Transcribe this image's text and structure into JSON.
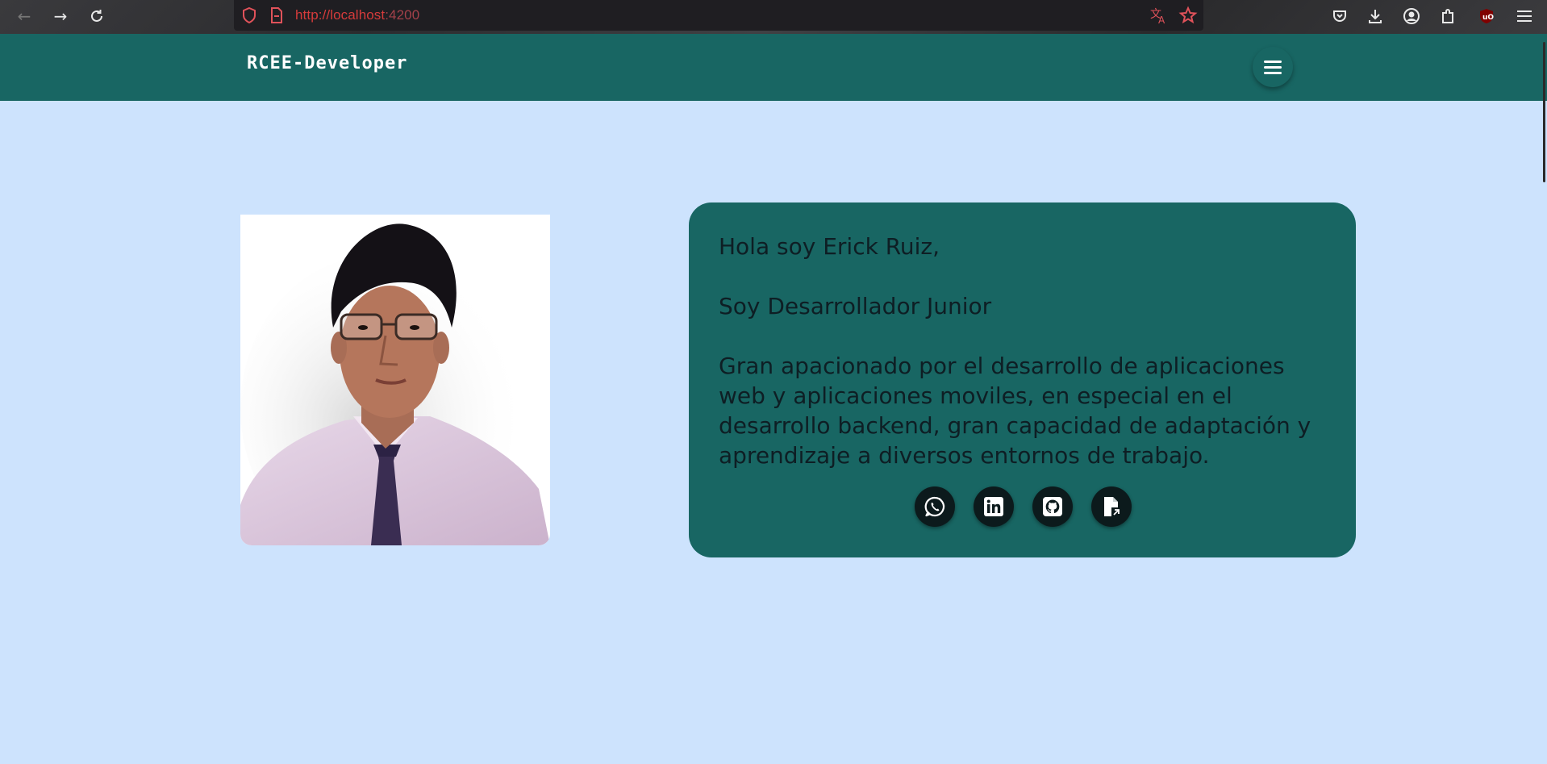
{
  "browser": {
    "url_host": "http://localhost",
    "url_port": ":4200"
  },
  "header": {
    "brand": "RCEE-Developer"
  },
  "card": {
    "greeting": "Hola soy Erick Ruiz,",
    "role": "Soy Desarrollador Junior",
    "bio": "Gran apacionado por el desarrollo de aplicaciones web y aplicaciones moviles, en especial en el desarrollo backend, gran capacidad de adaptación y aprendizaje a diversos entornos de trabajo."
  },
  "socials": [
    {
      "icon": "whatsapp-icon"
    },
    {
      "icon": "linkedin-icon"
    },
    {
      "icon": "github-icon"
    },
    {
      "icon": "file-download-icon"
    }
  ],
  "colors": {
    "page_bg": "#cde3fd",
    "accent": "#186663",
    "social_bg": "#0c1a1c"
  }
}
